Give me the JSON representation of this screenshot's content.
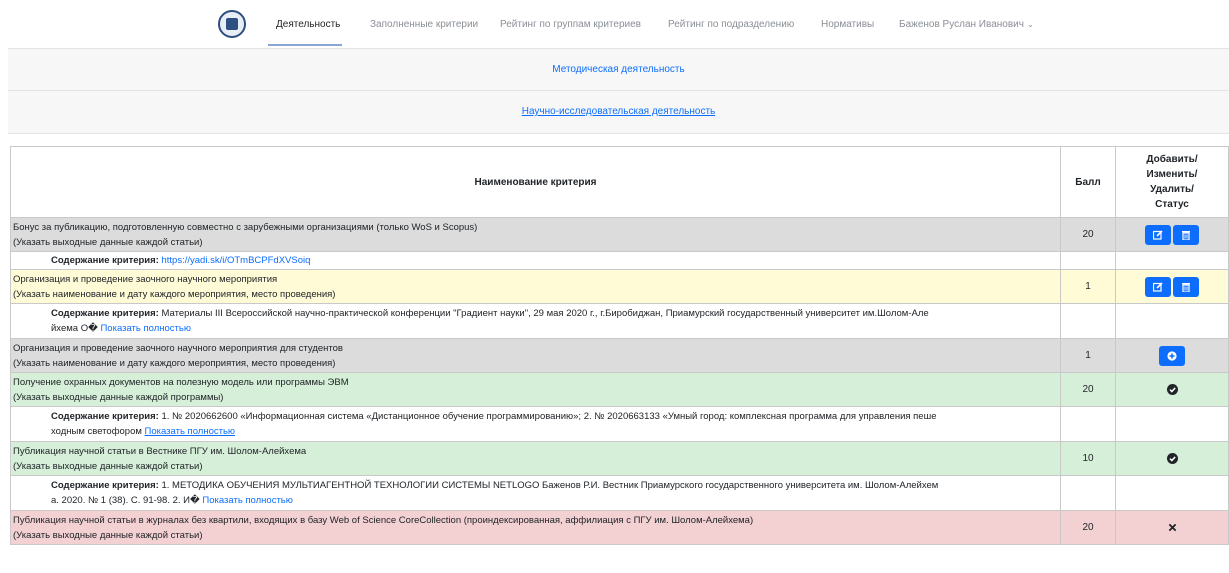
{
  "nav": {
    "items": [
      {
        "label": "Деятельность",
        "active": true
      },
      {
        "label": "Заполненные критерии"
      },
      {
        "label": "Рейтинг по группам критериев"
      },
      {
        "label": "Рейтинг по подразделению"
      },
      {
        "label": "Нормативы"
      }
    ],
    "user": "Баженов Руслан Иванович"
  },
  "sections": {
    "methodical": "Методическая деятельность",
    "research": "Научно-исследовательская деятельность"
  },
  "table": {
    "headers": {
      "name": "Наименование критерия",
      "score": "Балл",
      "actions": [
        "Добавить/",
        "Изменить/",
        "Удалить/",
        "Статус"
      ]
    },
    "rows": [
      {
        "title": "Бонус за публикацию, подготовленную совместно с зарубежными организациями (только WoS и Scopus)",
        "note": "(Указать выходные данные каждой статьи)",
        "score": "20",
        "color": "#dcdcdc",
        "actions": [
          "edit-icon",
          "trash-icon"
        ],
        "content_label": "Содержание критерия:",
        "content_link": "https://yadi.sk/i/OTmBCPFdXVSoiq"
      },
      {
        "title": "Организация и проведение заочного научного мероприятия",
        "note": "(Указать наименование и дату каждого мероприятия, место проведения)",
        "score": "1",
        "color": "#fffbd7",
        "actions": [
          "edit-icon",
          "trash-icon"
        ],
        "content_label": "Содержание критерия:",
        "content_text": "Материалы III Всероссийской научно-практической конференции \"Градиент науки\", 29 мая 2020 г., г.Биробиджан, Приамурский государственный университет им.Шолом-Але",
        "content_text2": "йхема О�",
        "show_more": "Показать полностью"
      },
      {
        "title": "Организация и проведение заочного научного мероприятия для студентов",
        "note": "(Указать наименование и дату каждого мероприятия, место проведения)",
        "score": "1",
        "color": "#dcdcdc",
        "actions": [
          "plus-circle-icon"
        ]
      },
      {
        "title": "Получение охранных документов на полезную модель или программы ЭВМ",
        "note": "(Указать выходные данные каждой программы)",
        "score": "20",
        "color": "#d6efd8",
        "status": "check-circle-icon",
        "content_label": "Содержание критерия:",
        "content_text": "1. № 2020662600 «Информационная система «Дистанционное обучение программированию»; 2. № 2020663133 «Умный город: комплексная программа для управления пеше",
        "content_text2": "ходным светофором",
        "show_more": "Показать полностью"
      },
      {
        "title": "Публикация научной статьи в Вестнике ПГУ им. Шолом-Алейхема",
        "note": "(Указать выходные данные каждой статьи)",
        "score": "10",
        "color": "#d6efd8",
        "status": "check-circle-icon",
        "content_label": "Содержание критерия:",
        "content_text": "1. МЕТОДИКА ОБУЧЕНИЯ МУЛЬТИАГЕНТНОЙ ТЕХНОЛОГИИ СИСТЕМЫ NETLOGO Баженов Р.И. Вестник Приамурского государственного университета им. Шолом-Алейхем",
        "content_text2": "а. 2020. № 1 (38). С. 91-98. 2. И�",
        "show_more": "Показать полностью"
      },
      {
        "title": "Публикация научной статьи в журналах без квартили, входящих в базу Web of Science CoreCollection (проиндексированная, аффилиация с ПГУ им. Шолом-Алейхема)",
        "note": "(Указать выходные данные каждой статьи)",
        "score": "20",
        "color": "#f3d1d3",
        "status": "x-icon"
      }
    ]
  }
}
